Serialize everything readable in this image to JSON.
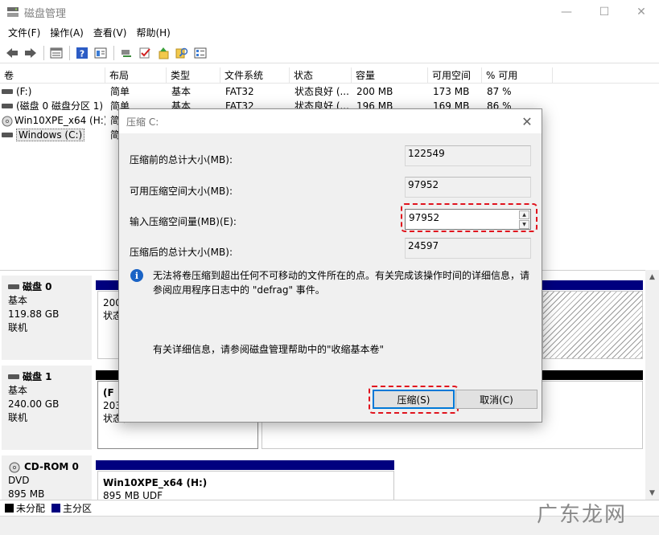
{
  "window": {
    "title": "磁盘管理",
    "min_glyph": "—",
    "max_glyph": "☐",
    "close_glyph": "✕"
  },
  "menu": [
    "文件(F)",
    "操作(A)",
    "查看(V)",
    "帮助(H)"
  ],
  "toolbar_icons": [
    "back-icon",
    "forward-icon",
    "disk-list-icon",
    "help-icon",
    "properties-icon",
    "connect-icon",
    "check-icon",
    "up-icon",
    "search-icon",
    "detail-icon"
  ],
  "volumes": {
    "columns": [
      "卷",
      "布局",
      "类型",
      "文件系统",
      "状态",
      "容量",
      "可用空间",
      "% 可用"
    ],
    "rows": [
      {
        "vol": "(F:)",
        "layout": "简单",
        "type": "基本",
        "fs": "FAT32",
        "status": "状态良好 (...",
        "capacity": "200 MB",
        "free": "173 MB",
        "pct": "87 %"
      },
      {
        "vol": "(磁盘 0 磁盘分区 1)",
        "layout": "简单",
        "type": "基本",
        "fs": "FAT32",
        "status": "状态良好 (...",
        "capacity": "196 MB",
        "free": "169 MB",
        "pct": "86 %"
      },
      {
        "vol": "Win10XPE_x64 (H:)",
        "layout": "简",
        "type": "",
        "fs": "",
        "status": "",
        "capacity": "",
        "free": "",
        "pct": ""
      },
      {
        "vol": "Windows (C:)",
        "layout": "简",
        "type": "",
        "fs": "",
        "status": "",
        "capacity": "",
        "free": "",
        "pct": ""
      }
    ]
  },
  "disks": [
    {
      "name": "磁盘 0",
      "kind": "基本",
      "size": "119.88 GB",
      "state": "联机",
      "part_line1": "200",
      "part_line2": "状态"
    },
    {
      "name": "磁盘 1",
      "kind": "基本",
      "size": "240.00 GB",
      "state": "联机",
      "part_line1": "(F",
      "part_line2": "203",
      "part_line3": "状态良"
    },
    {
      "name": "CD-ROM 0",
      "kind": "DVD",
      "size": "895 MB",
      "state": "",
      "part_line1": "Win10XPE_x64  (H:)",
      "part_line2": "895 MB UDF"
    }
  ],
  "legend": {
    "unallocated": "未分配",
    "primary": "主分区",
    "unallocated_color": "#000000",
    "primary_color": "#00007f"
  },
  "dialog": {
    "title": "压缩 C:",
    "total_before_label": "压缩前的总计大小(MB):",
    "total_before_value": "122549",
    "available_label": "可用压缩空间大小(MB):",
    "available_value": "97952",
    "input_label": "输入压缩空间量(MB)(E):",
    "input_value": "97952",
    "total_after_label": "压缩后的总计大小(MB):",
    "total_after_value": "24597",
    "info_text": "无法将卷压缩到超出任何不可移动的文件所在的点。有关完成该操作时间的详细信息，请参阅应用程序日志中的 \"defrag\" 事件。",
    "help_text": "有关详细信息，请参阅磁盘管理帮助中的\"收缩基本卷\"",
    "shrink_button": "压缩(S)",
    "cancel_button": "取消(C)",
    "highlight_color": "#e0141e"
  },
  "watermark": "广东龙网"
}
